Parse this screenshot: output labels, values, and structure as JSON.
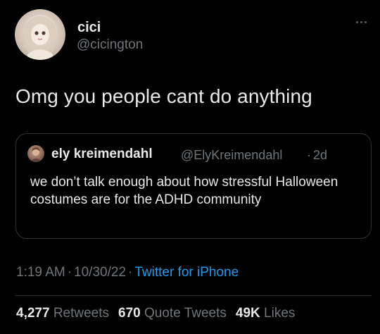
{
  "tweet": {
    "author": {
      "display_name": "cici",
      "handle": "@cicington",
      "avatar_icon": "doll-photo-avatar"
    },
    "more_icon": "more-dots-icon",
    "text": "Omg you people cant do anything",
    "quoted": {
      "author": {
        "display_name": "ely kreimendahl",
        "handle": "@ElyKreimendahl",
        "separator": "·",
        "age": "2d",
        "avatar_icon": "person-photo-avatar"
      },
      "text": "we don’t talk enough about how stressful Halloween costumes are for the ADHD community"
    },
    "meta": {
      "time": "1:19 AM",
      "separator": "·",
      "date": "10/30/22",
      "separator2": "·",
      "source": "Twitter for iPhone"
    },
    "stats": {
      "retweets_count": "4,277",
      "retweets_label": "Retweets",
      "quote_tweets_count": "670",
      "quote_tweets_label": "Quote Tweets",
      "likes_count": "49K",
      "likes_label": "Likes"
    }
  },
  "colors": {
    "background": "#000000",
    "text_primary": "#e7e9ea",
    "text_secondary": "#71767b",
    "link": "#1d9bf0",
    "border": "#2f3336"
  }
}
